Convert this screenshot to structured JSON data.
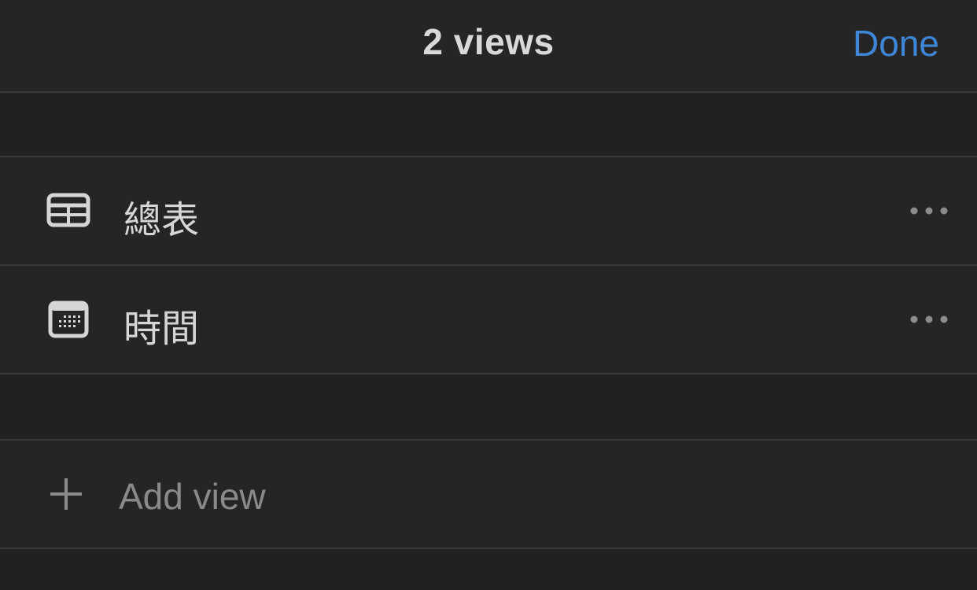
{
  "header": {
    "title": "2 views",
    "done_label": "Done"
  },
  "views": [
    {
      "label": "總表",
      "icon": "table-icon"
    },
    {
      "label": "時間",
      "icon": "calendar-icon"
    }
  ],
  "add_view": {
    "label": "Add view",
    "icon": "plus-icon"
  },
  "colors": {
    "accent": "#3d86d8",
    "background": "#212121",
    "row_background": "#252525",
    "text": "#d6d6d6",
    "muted": "#8a8a8a"
  }
}
